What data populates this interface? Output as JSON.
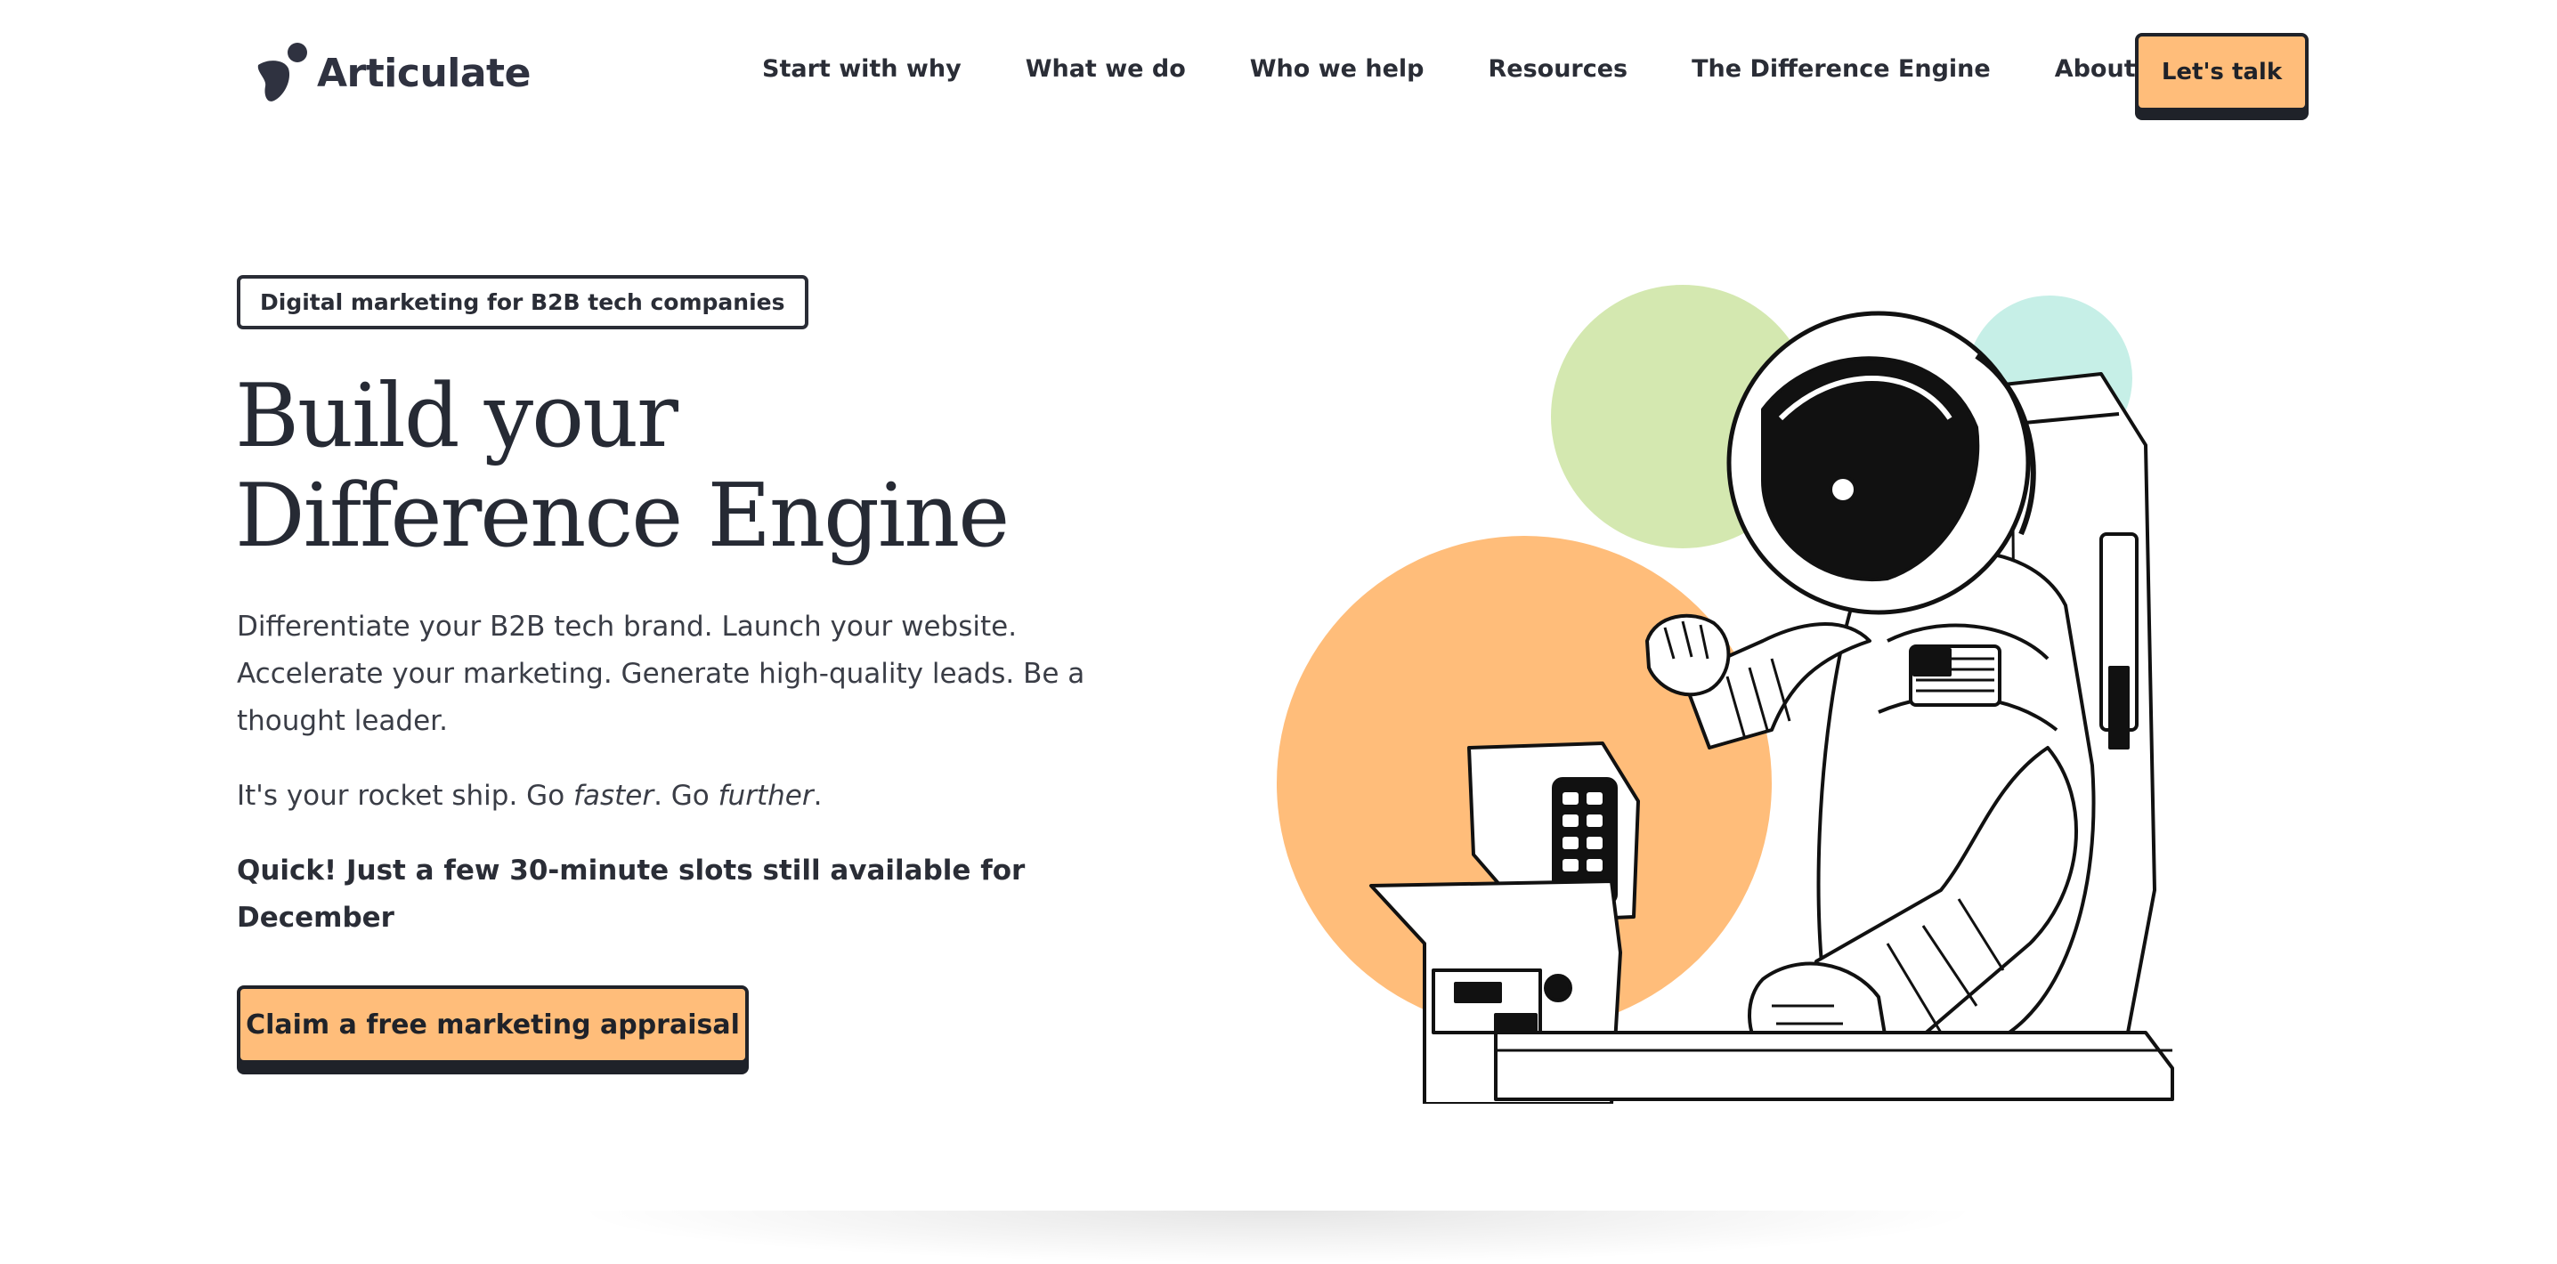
{
  "brand": {
    "name": "Articulate",
    "logo_icon": "articulate-logo-icon"
  },
  "nav": {
    "items": [
      {
        "label": "Start with why"
      },
      {
        "label": "What we do"
      },
      {
        "label": "Who we help"
      },
      {
        "label": "Resources"
      },
      {
        "label": "The Difference Engine"
      },
      {
        "label": "About us"
      }
    ],
    "cta_label": "Let's talk"
  },
  "hero": {
    "tag": "Digital marketing for B2B tech companies",
    "title_lines": [
      "Build your",
      "Difference Engine"
    ],
    "lead_lines": [
      "Differentiate your B2B tech brand. Launch your website.",
      "Accelerate your marketing. Generate high-quality leads. Be a",
      "thought leader."
    ],
    "rocket": {
      "prefix": "It's your rocket ship. Go ",
      "faster": "faster",
      "middle": ". Go ",
      "further": "further",
      "suffix": "."
    },
    "quick_lines": [
      "Quick! Just a few 30-minute slots still available for",
      "December"
    ],
    "cta_label": "Claim a free marketing appraisal"
  },
  "illustration": {
    "subject": "astronaut-at-control-panel-illustration",
    "colors": {
      "green": "#d4e8b0",
      "mint": "#c6efe7",
      "orange": "#ffbd7a"
    }
  },
  "colors": {
    "accent": "#ffbd7a",
    "text": "#2a2d36",
    "border": "#1f2229"
  }
}
